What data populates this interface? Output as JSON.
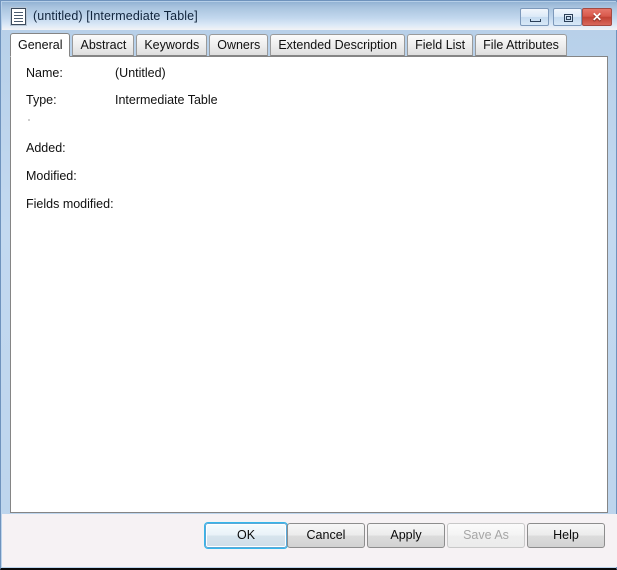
{
  "window": {
    "title": "(untitled) [Intermediate Table]",
    "icon": "document-icon",
    "controls": {
      "minimize_label": "–",
      "maximize_label": "□",
      "close_label": "✕"
    },
    "frame_color": "#bcd4ec",
    "titlebar_accent": "#93b3d4",
    "close_button_color": "#c24234"
  },
  "tabs": [
    {
      "label": "General",
      "active": true
    },
    {
      "label": "Abstract",
      "active": false
    },
    {
      "label": "Keywords",
      "active": false
    },
    {
      "label": "Owners",
      "active": false
    },
    {
      "label": "Extended Description",
      "active": false
    },
    {
      "label": "Field List",
      "active": false
    },
    {
      "label": "File Attributes",
      "active": false
    }
  ],
  "general_tab": {
    "fields": [
      {
        "label": "Name:",
        "value": "(Untitled)"
      },
      {
        "label": "Type:",
        "value": "Intermediate Table"
      },
      {
        "label": "Added:",
        "value": ""
      },
      {
        "label": "Modified:",
        "value": ""
      },
      {
        "label": "Fields modified:",
        "value": ""
      }
    ]
  },
  "footer": {
    "buttons": [
      {
        "label": "OK",
        "state": "default-focused"
      },
      {
        "label": "Cancel",
        "state": "enabled"
      },
      {
        "label": "Apply",
        "state": "enabled"
      },
      {
        "label": "Save As",
        "state": "disabled"
      },
      {
        "label": "Help",
        "state": "enabled"
      }
    ],
    "focus_color": "#36b6ea",
    "disabled_text_color": "#a6a6a6"
  }
}
